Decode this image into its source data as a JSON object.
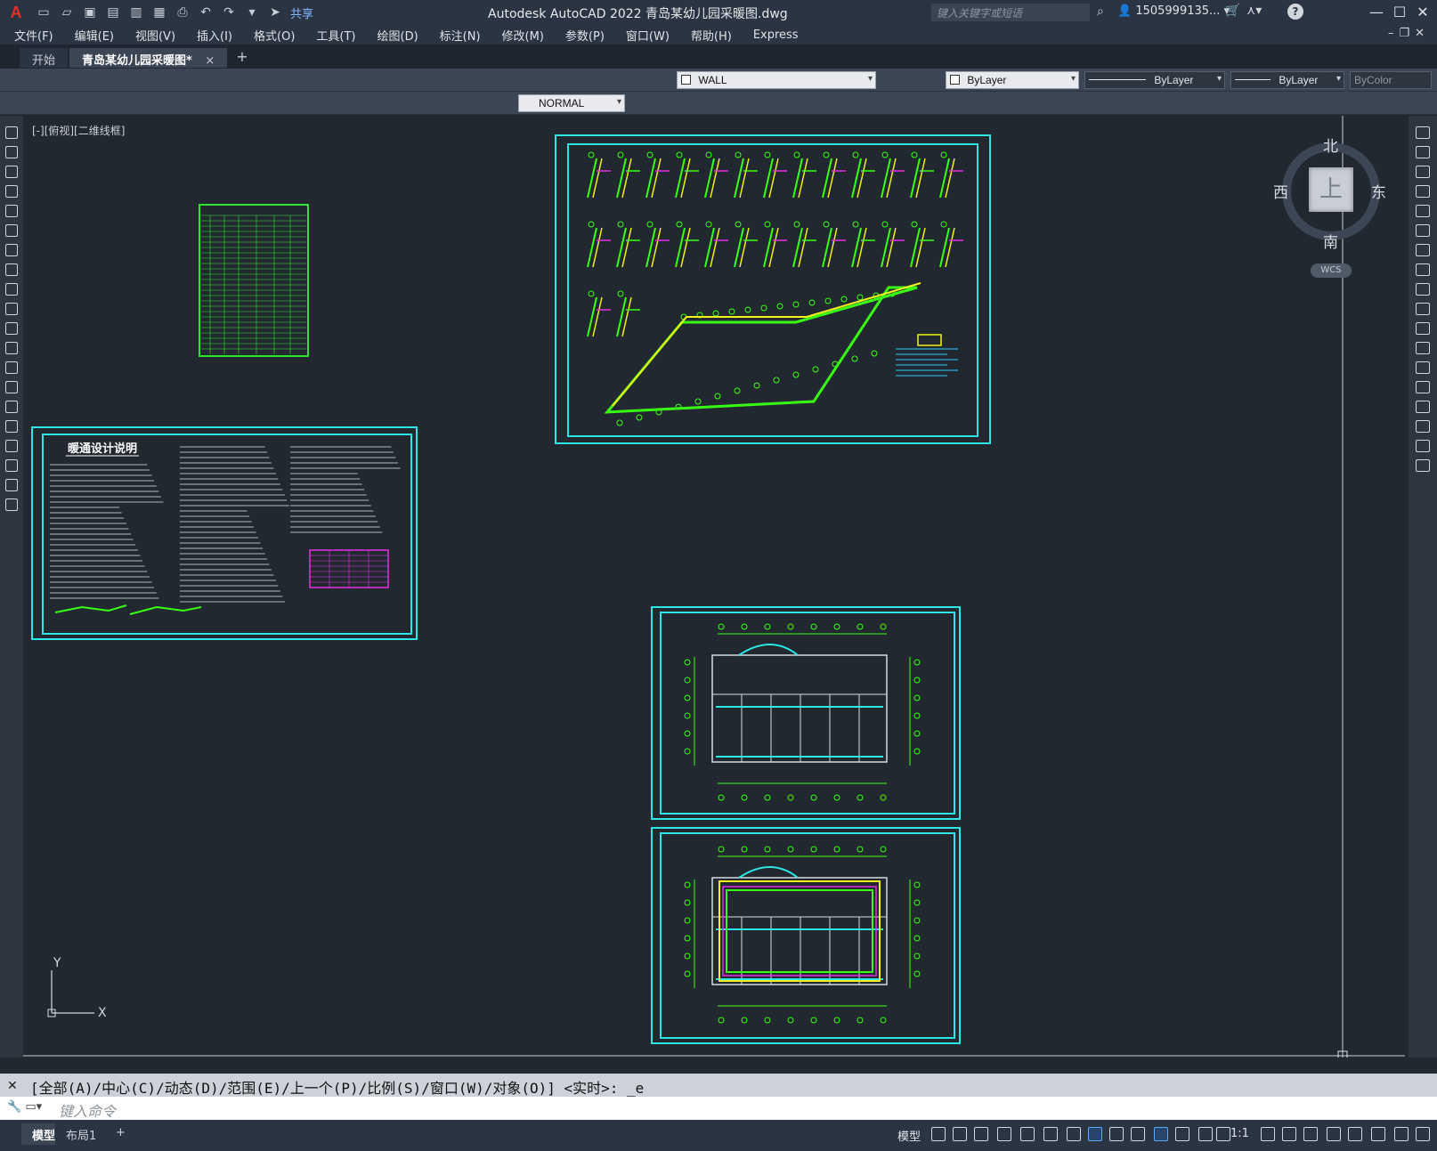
{
  "titlebar": {
    "logo": "A",
    "share_label": "共享",
    "app_title": "Autodesk AutoCAD 2022    青岛某幼儿园采暖图.dwg",
    "search_placeholder": "键入关键字或短语",
    "user_name": "1505999135..."
  },
  "menus": [
    "文件(F)",
    "编辑(E)",
    "视图(V)",
    "插入(I)",
    "格式(O)",
    "工具(T)",
    "绘图(D)",
    "标注(N)",
    "修改(M)",
    "参数(P)",
    "窗口(W)",
    "帮助(H)",
    "Express"
  ],
  "tabs": {
    "start": "开始",
    "active": "青岛某幼儿园采暖图*",
    "close": "×",
    "new": "+"
  },
  "toolbar": {
    "layer": "WALL",
    "color": "ByLayer",
    "linetype": "ByLayer",
    "lineweight": "ByLayer",
    "plotstyle": "ByColor",
    "textstyle": "NORMAL"
  },
  "viewport": {
    "label": "[-][俯视][二维线框]",
    "compass_n": "北",
    "compass_s": "南",
    "compass_e": "东",
    "compass_w": "西",
    "cube_face": "上",
    "wcs": "WCS",
    "ucs_x": "X",
    "ucs_y": "Y"
  },
  "sheets": {
    "design_notes_title": "暖通设计说明"
  },
  "command": {
    "history": "[全部(A)/中心(C)/动态(D)/范围(E)/上一个(P)/比例(S)/窗口(W)/对象(O)] <实时>: _e",
    "placeholder": "键入命令"
  },
  "status": {
    "tab_model": "模型",
    "tab_layout1": "布局1",
    "add": "+",
    "model_label": "模型",
    "scale": "1:1"
  },
  "colors": {
    "frame_cyan": "#2ee6e6",
    "pipe_green": "#39ff14",
    "pipe_yellow": "#f2f21a",
    "magenta": "#e62ee6"
  }
}
